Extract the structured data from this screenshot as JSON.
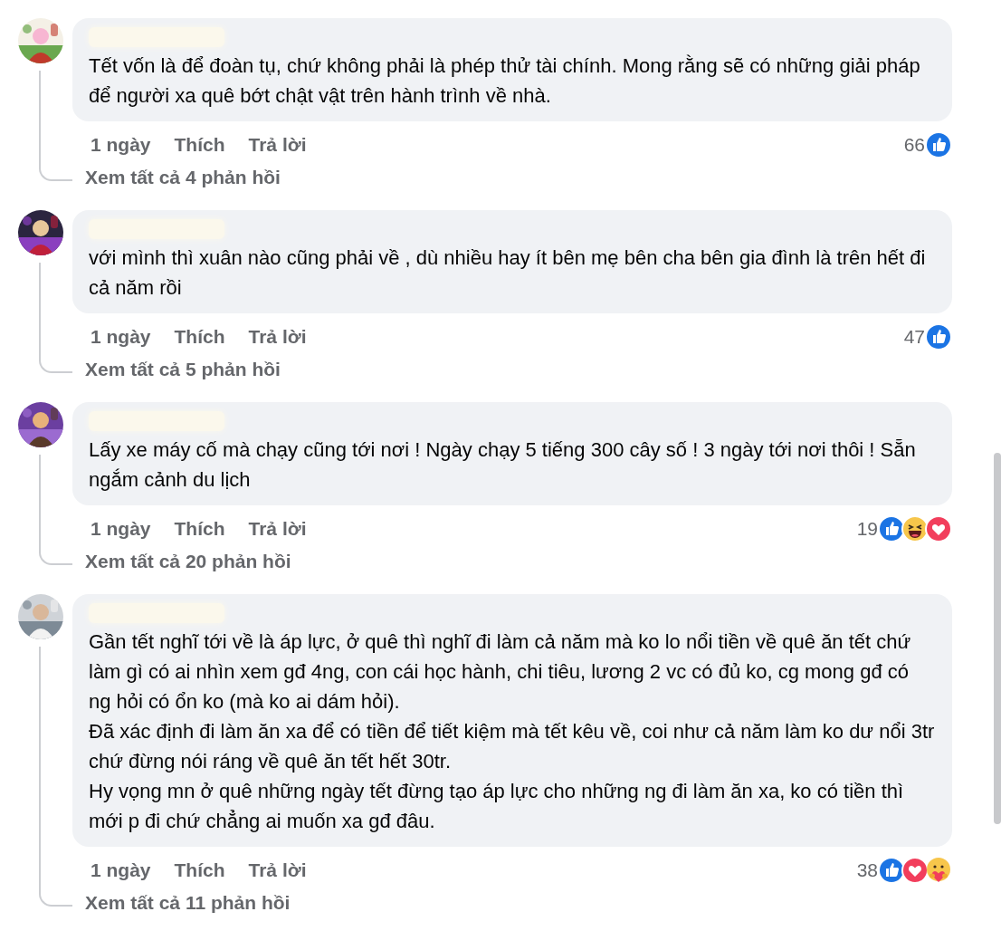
{
  "comments": [
    {
      "avatar": {
        "kind": "picture"
      },
      "paragraphs": [
        "Tết vốn là để đoàn tụ, chứ không phải là phép thử tài chính. Mong rằng sẽ có những giải pháp để người xa quê bớt chật vật trên hành trình về nhà."
      ],
      "time": "1 ngày",
      "like": "Thích",
      "reply": "Trả lời",
      "count": "66",
      "reactions": [
        {
          "kind": "like"
        }
      ],
      "replies_link": "Xem tất cả 4 phản hồi"
    },
    {
      "avatar": {
        "kind": "picture"
      },
      "paragraphs": [
        "với mình thì xuân nào cũng phải về , dù nhiều hay ít bên mẹ bên cha bên gia đình là trên hết đi cả năm rồi"
      ],
      "time": "1 ngày",
      "like": "Thích",
      "reply": "Trả lời",
      "count": "47",
      "reactions": [
        {
          "kind": "like"
        }
      ],
      "replies_link": "Xem tất cả 5 phản hồi"
    },
    {
      "avatar": {
        "kind": "picture"
      },
      "paragraphs": [
        "Lấy xe máy cố mà chạy cũng tới nơi ! Ngày chạy 5 tiếng 300 cây số ! 3 ngày tới nơi thôi ! Sẵn ngắm cảnh du lịch"
      ],
      "time": "1 ngày",
      "like": "Thích",
      "reply": "Trả lời",
      "count": "19",
      "reactions": [
        {
          "kind": "like"
        },
        {
          "kind": "haha"
        },
        {
          "kind": "love"
        }
      ],
      "replies_link": "Xem tất cả 20 phản hồi"
    },
    {
      "avatar": {
        "kind": "picture"
      },
      "paragraphs": [
        "Gần tết nghĩ tới về là áp lực, ở quê thì nghĩ đi làm cả năm mà ko lo nổi tiền về quê ăn tết chứ làm gì có ai nhìn xem gđ 4ng, con cái học hành, chi tiêu, lương 2 vc có đủ ko, cg mong gđ có ng hỏi có ổn ko (mà ko ai dám hỏi).",
        "Đã xác định đi làm ăn xa để có tiền để tiết kiệm mà tết kêu về, coi như cả năm làm ko dư nổi 3tr chứ đừng nói ráng về quê ăn tết hết 30tr.",
        "Hy vọng mn ở quê những ngày tết đừng tạo áp lực cho những ng đi làm ăn xa, ko có tiền thì mới p đi chứ chẳng ai muốn xa gđ đâu."
      ],
      "time": "1 ngày",
      "like": "Thích",
      "reply": "Trả lời",
      "count": "38",
      "reactions": [
        {
          "kind": "like"
        },
        {
          "kind": "love"
        },
        {
          "kind": "care"
        }
      ],
      "replies_link": "Xem tất cả 11 phản hồi"
    }
  ]
}
